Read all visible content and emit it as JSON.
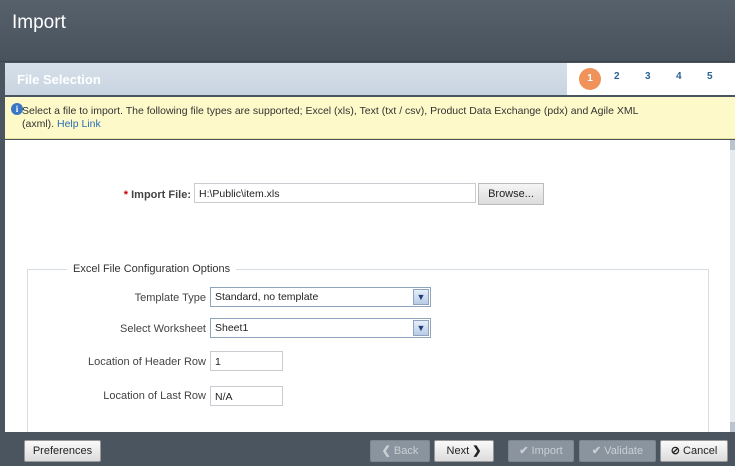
{
  "header": {
    "title": "Import"
  },
  "steps": {
    "title": "File Selection",
    "items": [
      "1",
      "2",
      "3",
      "4",
      "5"
    ]
  },
  "info": {
    "text": "Select a file to import. The following file types are supported; Excel (xls), Text (txt / csv), Product Data Exchange (pdx) and Agile XML (axml). ",
    "help_link": "Help Link"
  },
  "import_file": {
    "required_mark": "*",
    "label": "Import File:",
    "value": "H:\\Public\\item.xls",
    "browse_label": "Browse..."
  },
  "config": {
    "legend": "Excel File Configuration Options",
    "template_type": {
      "label": "Template Type",
      "value": "Standard, no template"
    },
    "worksheet": {
      "label": "Select Worksheet",
      "value": "Sheet1"
    },
    "header_row": {
      "label": "Location of Header Row",
      "value": "1"
    },
    "last_row": {
      "label": "Location of Last Row",
      "value": "N/A"
    }
  },
  "footer": {
    "preferences": "Preferences",
    "back": "Back",
    "next": "Next",
    "import": "Import",
    "validate": "Validate",
    "cancel": "Cancel"
  },
  "icons": {
    "info": "info-icon",
    "dropdown": "chevron-down-icon",
    "back": "chevron-left-icon",
    "next": "chevron-right-icon",
    "check": "checkmark-icon",
    "cancel": "cancel-circle-icon"
  },
  "colors": {
    "active_step": "#f0935a",
    "link": "#2a6eb5",
    "info_bg": "#fdf9c8",
    "chrome": "#4a5560"
  }
}
